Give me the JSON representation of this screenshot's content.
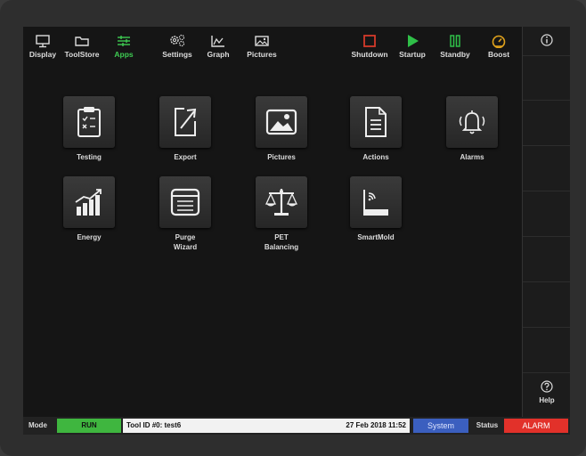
{
  "toolbar": {
    "left_items": [
      {
        "label": "Display",
        "icon": "monitor-icon"
      },
      {
        "label": "ToolStore",
        "icon": "folder-icon"
      },
      {
        "label": "Apps",
        "icon": "sliders-icon",
        "active": true
      },
      {
        "label": "Settings",
        "icon": "gears-icon"
      },
      {
        "label": "Graph",
        "icon": "graph-icon"
      },
      {
        "label": "Pictures",
        "icon": "image-icon"
      }
    ],
    "right_items": [
      {
        "label": "Shutdown",
        "icon": "stop-icon",
        "color": "#d43a2a"
      },
      {
        "label": "Startup",
        "icon": "play-icon",
        "color": "#2fbf48"
      },
      {
        "label": "Standby",
        "icon": "pause-icon",
        "color": "#2fbf48"
      },
      {
        "label": "Boost",
        "icon": "gauge-icon",
        "color": "#e0a21c"
      }
    ],
    "active_color": "#3ecb52"
  },
  "apps": [
    {
      "label": "Testing",
      "icon": "clipboard-icon"
    },
    {
      "label": "Export",
      "icon": "export-icon"
    },
    {
      "label": "Pictures",
      "icon": "picture-icon"
    },
    {
      "label": "Actions",
      "icon": "document-icon"
    },
    {
      "label": "Alarms",
      "icon": "bell-icon"
    },
    {
      "label": "Energy",
      "icon": "energy-chart-icon"
    },
    {
      "label": "Purge\nWizard",
      "icon": "purge-window-icon"
    },
    {
      "label": "PET\nBalancing",
      "icon": "scale-icon"
    },
    {
      "label": "SmartMold",
      "icon": "wifi-mold-icon"
    }
  ],
  "sidebar": {
    "info_icon": "info-icon",
    "help_icon": "help-icon",
    "help_label": "Help"
  },
  "statusbar": {
    "mode_label": "Mode",
    "mode_value": "RUN",
    "mode_color": "#3fb63f",
    "tool_id": "Tool ID #0: test6",
    "datetime": "27 Feb 2018 11:52",
    "system_label": "System",
    "system_color": "#3b5fbf",
    "status_label": "Status",
    "alarm_label": "ALARM",
    "alarm_color": "#e2312a"
  }
}
